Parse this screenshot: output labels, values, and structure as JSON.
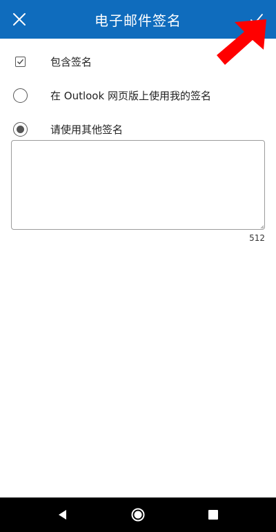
{
  "header": {
    "title": "电子邮件签名",
    "close_icon": "close-icon",
    "confirm_icon": "checkmark-icon",
    "background_color": "#0f6cbd"
  },
  "options": [
    {
      "label": "包含签名",
      "control": "checkbox",
      "checked": true
    },
    {
      "label": "在 Outlook 网页版上使用我的签名",
      "control": "radio",
      "selected": false
    },
    {
      "label": "请使用其他签名",
      "control": "radio",
      "selected": true
    }
  ],
  "signature": {
    "value": "",
    "remaining_chars": "512"
  },
  "annotation": {
    "type": "red-arrow",
    "points_to": "confirm-button",
    "color": "#ff0000"
  },
  "navbar": {
    "back_icon": "back-triangle-icon",
    "home_icon": "home-circle-icon",
    "recents_icon": "recents-square-icon"
  }
}
